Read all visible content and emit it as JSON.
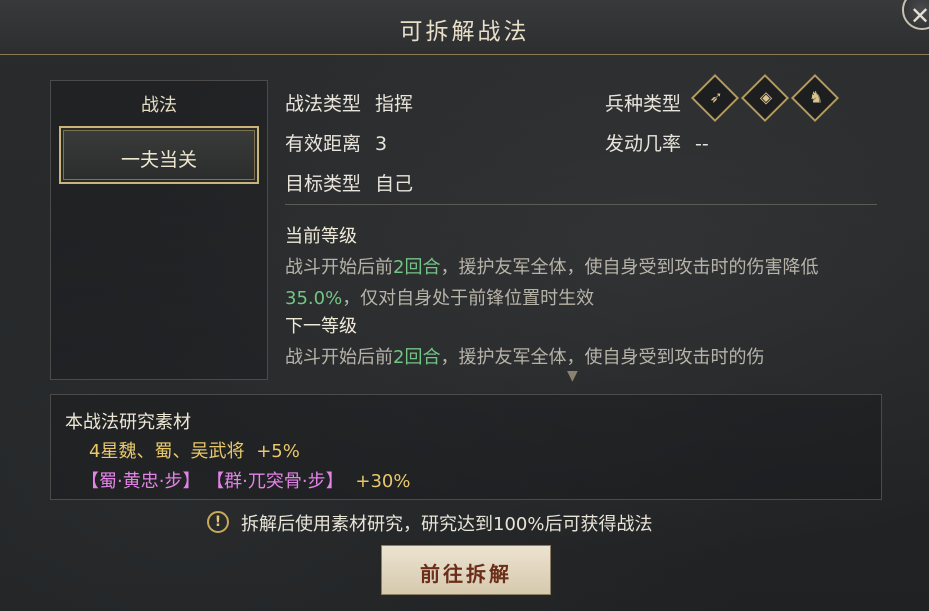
{
  "dialog": {
    "title": "可拆解战法",
    "close_glyph": "✕"
  },
  "left_panel": {
    "header": "战法",
    "selected_skill": "一夫当关"
  },
  "info": {
    "type_label": "战法类型",
    "type_value": "指挥",
    "range_label": "有效距离",
    "range_value": "3",
    "target_label": "目标类型",
    "target_value": "自己",
    "unit_label": "兵种类型",
    "rate_label": "发动几率",
    "rate_value": "--",
    "unit_icons": [
      "bow-icon",
      "shield-icon",
      "horse-icon"
    ]
  },
  "description": {
    "current_title": "当前等级",
    "current_text_a": "战斗开始后前",
    "current_rounds": "2回合",
    "current_text_b": "，援护友军全体，使自身受到攻击时的伤害降低",
    "current_pct": "35.0%",
    "current_text_c": "，仅对自身处于前锋位置时生效",
    "next_title": "下一等级",
    "next_text_a": "战斗开始后前",
    "next_rounds": "2回合",
    "next_text_b": "，援护友军全体，使自身受到攻击时的伤"
  },
  "materials": {
    "title": "本战法研究素材",
    "line1_generals": "4星魏、蜀、吴武将",
    "line1_bonus": "+5%",
    "line2_general_a": "【蜀·黄忠·步】",
    "line2_general_b": "【群·兀突骨·步】",
    "line2_bonus": "+30%"
  },
  "tip": {
    "icon_glyph": "!",
    "text": "拆解后使用素材研究，研究达到100%后可获得战法"
  },
  "action": {
    "label": "前往拆解"
  },
  "colors": {
    "accent_gold": "#c9b47a",
    "highlight_green": "#74c485",
    "bonus_yellow": "#e8c86a",
    "general_pink": "#e283e6",
    "button_text": "#6a2e1a"
  }
}
